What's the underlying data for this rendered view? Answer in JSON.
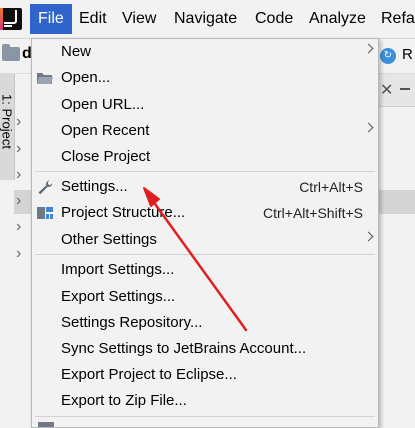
{
  "menubar": {
    "items": [
      {
        "label": "File",
        "active": true
      },
      {
        "label": "Edit"
      },
      {
        "label": "View"
      },
      {
        "label": "Navigate"
      },
      {
        "label": "Code"
      },
      {
        "label": "Analyze"
      },
      {
        "label": "Refa"
      }
    ]
  },
  "toolbar": {
    "breadcrumb_start": "d",
    "run_label": "R"
  },
  "side_panel": {
    "tab_label": "1: Project"
  },
  "file_menu": {
    "new": "New",
    "open": "Open...",
    "open_url": "Open URL...",
    "open_recent": "Open Recent",
    "close_project": "Close Project",
    "settings": "Settings...",
    "settings_shortcut": "Ctrl+Alt+S",
    "project_structure": "Project Structure...",
    "project_structure_shortcut": "Ctrl+Alt+Shift+S",
    "other_settings": "Other Settings",
    "import_settings": "Import Settings...",
    "export_settings": "Export Settings...",
    "settings_repository": "Settings Repository...",
    "sync_settings": "Sync Settings to JetBrains Account...",
    "export_eclipse": "Export Project to Eclipse...",
    "export_zip": "Export to Zip File..."
  },
  "colors": {
    "menu_active": "#2f65ca",
    "annotation_arrow": "#e02020"
  }
}
